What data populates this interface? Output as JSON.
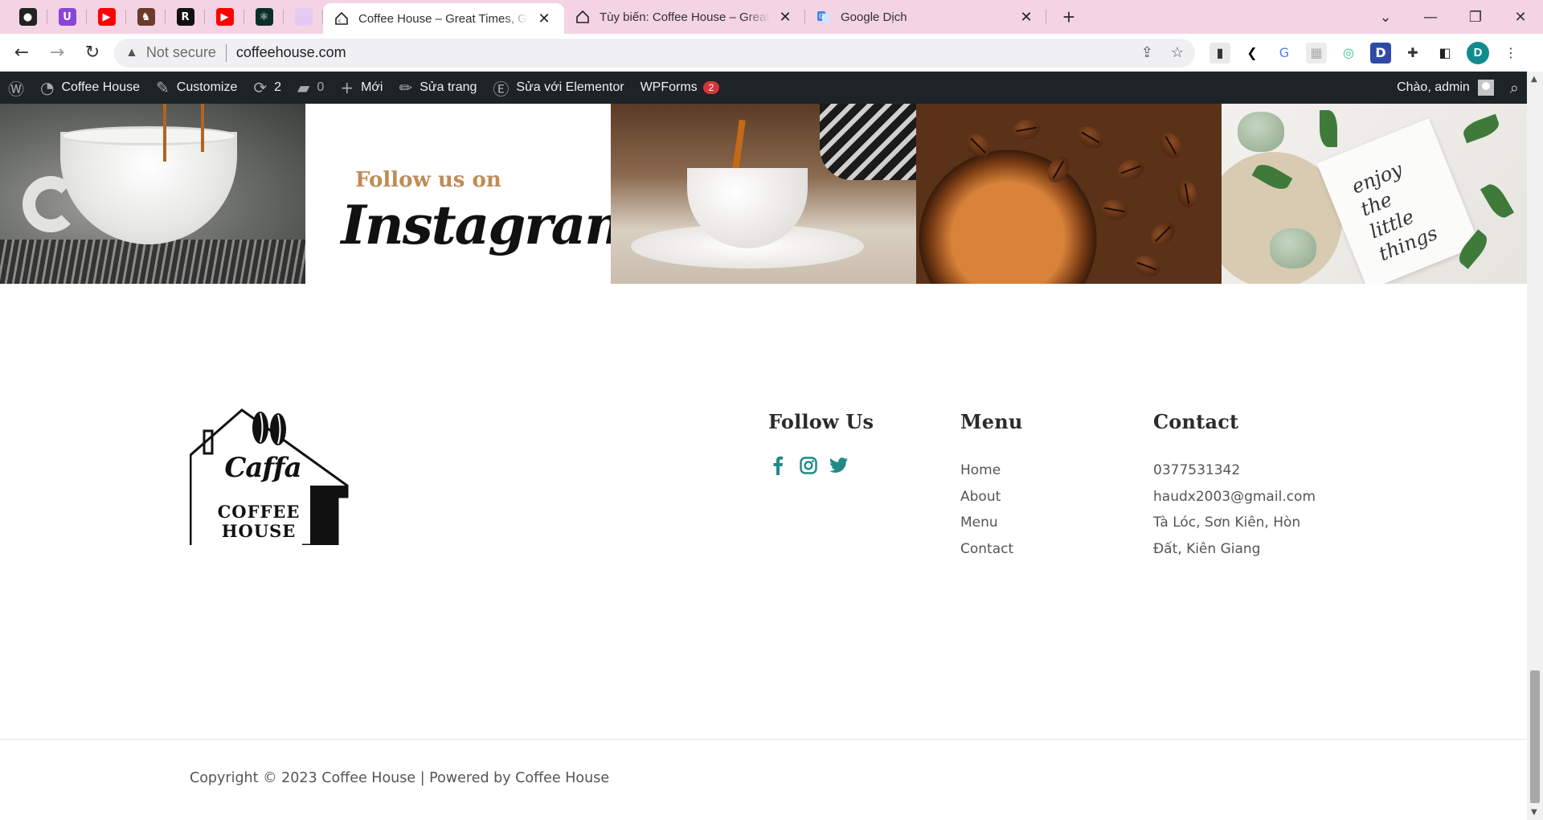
{
  "browser": {
    "pinned_tabs": [
      {
        "icon": "github-icon",
        "color": "#222222",
        "glyph": "●"
      },
      {
        "icon": "fpt-icon",
        "color": "#8b45d6",
        "glyph": "U"
      },
      {
        "icon": "youtube-icon",
        "color": "#ff0000",
        "glyph": "▶"
      },
      {
        "icon": "character-icon",
        "color": "#6b3b2b",
        "glyph": "♞"
      },
      {
        "icon": "notion-like-icon",
        "color": "#111111",
        "glyph": "R"
      },
      {
        "icon": "youtube-icon",
        "color": "#ff0000",
        "glyph": "▶"
      },
      {
        "icon": "react-icon",
        "color": "#0d2f2a",
        "glyph": "⚛"
      },
      {
        "icon": "blank-page-icon",
        "color": "#e4c9f2",
        "glyph": ""
      }
    ],
    "tabs": [
      {
        "title": "Coffee House – Great Times, Good Coffee",
        "active": true
      },
      {
        "title": "Tùy biến: Coffee House – Great Times",
        "active": false
      },
      {
        "title": "Google Dịch",
        "active": false
      }
    ],
    "new_tab": "+",
    "address": {
      "security": "Not secure",
      "url": "coffeehouse.com"
    },
    "profile_initial": "D"
  },
  "wp_admin_bar": {
    "site_name": "Coffee House",
    "customize": "Customize",
    "updates_count": "2",
    "comments_count": "0",
    "new": "Mới",
    "edit_page": "Sửa trang",
    "elementor": "Sửa với Elementor",
    "wpforms": "WPForms",
    "wpforms_badge": "2",
    "greeting": "Chào, admin"
  },
  "gallery": {
    "follow_text": "Follow us on",
    "instagram_text": "Instagram",
    "note_text": "enjoy\nthe\nlittle\nthings"
  },
  "footer": {
    "logo_script": "Caffa",
    "logo_line1": "COFFEE",
    "logo_line2": "HOUSE",
    "follow_heading": "Follow Us",
    "menu_heading": "Menu",
    "menu_items": [
      "Home",
      "About",
      "Menu",
      "Contact"
    ],
    "contact_heading": "Contact",
    "contact_lines": [
      "0377531342",
      "haudx2003@gmail.com",
      "Tà Lóc, Sơn Kiên, Hòn",
      "Đất, Kiên Giang"
    ],
    "social_color": "#1f8a87",
    "copyright": "Copyright © 2023 Coffee House | Powered by Coffee House"
  }
}
